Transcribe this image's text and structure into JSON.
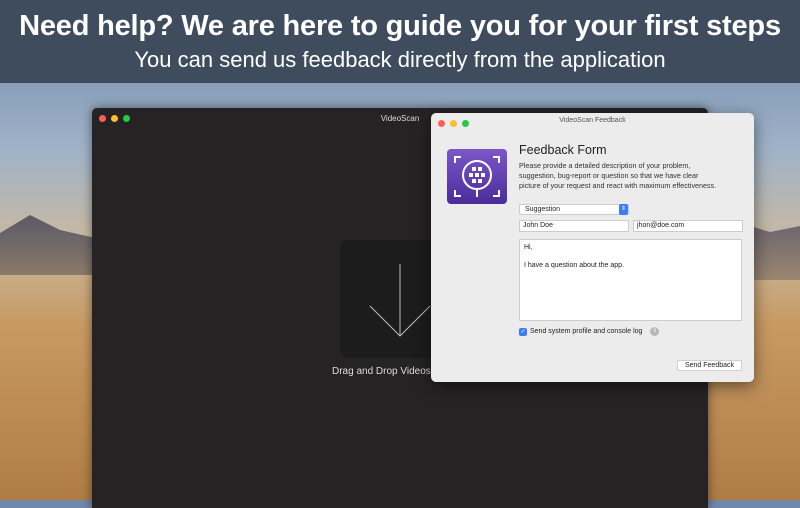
{
  "banner": {
    "headline": "Need help? We are here to guide you for your first steps",
    "subline": "You can send us feedback directly from the application"
  },
  "main_window": {
    "title": "VideoScan",
    "drop_label": "Drag and Drop Videos"
  },
  "feedback_window": {
    "title": "VideoScan Feedback",
    "heading": "Feedback Form",
    "description": "Please provide a detailed description of your problem, suggestion, bug-report or question so that we have clear picture of your request and react with maximum effectiveness.",
    "type_select": "Suggestion",
    "name_value": "John Doe",
    "email_value": "jhon@doe.com",
    "message_line1": "Hi,",
    "message_line2": "I have a question about the app.",
    "checkbox_label": "Send system profile and console log",
    "checkbox_checked": true,
    "send_button": "Send Feedback"
  }
}
